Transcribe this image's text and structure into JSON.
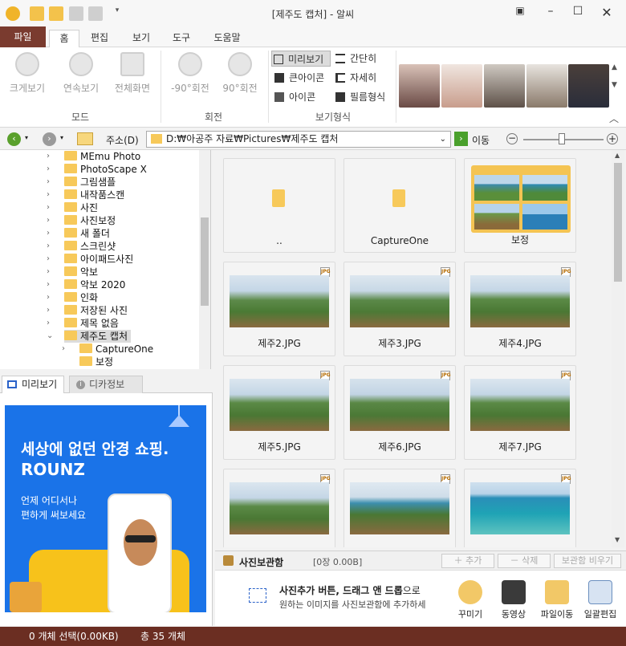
{
  "window": {
    "title": "[제주도 캡처] - 알씨"
  },
  "tabs": [
    "파일",
    "홈",
    "편집",
    "보기",
    "도구",
    "도움말"
  ],
  "ribbon": {
    "mode_buttons": [
      "크게보기",
      "연속보기",
      "전체화면"
    ],
    "mode_label": "모드",
    "rotate_buttons": [
      "-90°회전",
      "90°회전"
    ],
    "rotate_label": "회전",
    "view_options": [
      "미리보기",
      "간단히",
      "큰아이콘",
      "자세히",
      "아이콘",
      "필름형식"
    ],
    "view_label": "보기형식"
  },
  "address": {
    "label": "주소(D)",
    "path": "D:₩아공주 자료₩Pictures₩제주도 캡처",
    "go": "이동"
  },
  "tree": [
    "MEmu Photo",
    "PhotoScape X",
    "그림샘플",
    "내작품스캔",
    "사진",
    "사진보정",
    "새 폴더",
    "스크린샷",
    "아이패드사진",
    "악보",
    "악보 2020",
    "인화",
    "저장된 사진",
    "제목 없음",
    "제주도 캡처",
    "CaptureOne",
    "보정"
  ],
  "panel_tabs": [
    "미리보기",
    "디카정보"
  ],
  "ad": {
    "line1": "세상에 없던 안경 쇼핑.",
    "line2": "ROUNZ",
    "line3": "언제 어디서나",
    "line4": "편하게 써보세요"
  },
  "files": [
    "..",
    "CaptureOne",
    "보정",
    "제주2.JPG",
    "제주3.JPG",
    "제주4.JPG",
    "제주5.JPG",
    "제주6.JPG",
    "제주7.JPG",
    "",
    "",
    ""
  ],
  "jpg_badge": "JPG",
  "bucket": {
    "title": "사진보관함",
    "count": "[0장 0.00B]",
    "add": "추가",
    "delete": "삭제",
    "empty": "보관함 비우기",
    "hint_bold": "사진추가 버튼, 드래그 앤 드롭",
    "hint_tail": "으로",
    "hint2": "원하는 이미지를 사진보관함에 추가하세",
    "tools": [
      "꾸미기",
      "동영상",
      "파일이동",
      "일괄편집"
    ]
  },
  "status": {
    "selected": "0 개체 선택(0.00KB)",
    "total": "총 35 개체"
  },
  "colors": {
    "accent": "#7a3b2f",
    "status_bar": "#6b2e22",
    "ad_blue": "#1a73e8"
  }
}
